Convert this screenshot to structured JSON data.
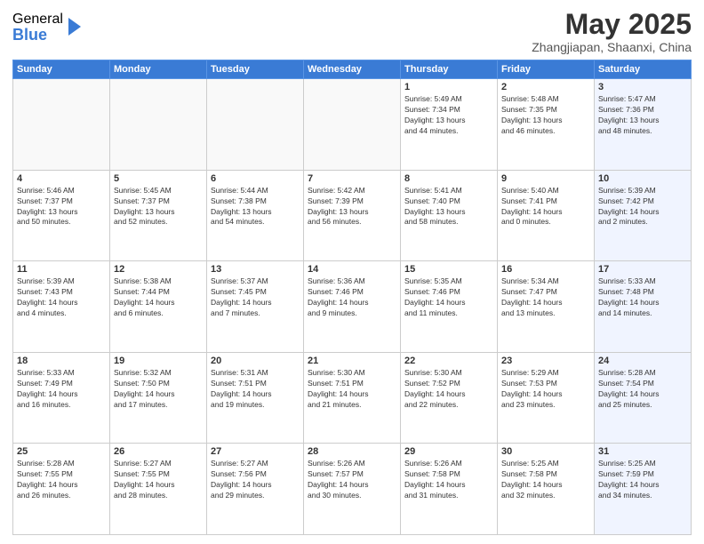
{
  "logo": {
    "general": "General",
    "blue": "Blue"
  },
  "title": {
    "month": "May 2025",
    "location": "Zhangjiapan, Shaanxi, China"
  },
  "weekdays": [
    "Sunday",
    "Monday",
    "Tuesday",
    "Wednesday",
    "Thursday",
    "Friday",
    "Saturday"
  ],
  "weeks": [
    [
      {
        "day": "",
        "info": ""
      },
      {
        "day": "",
        "info": ""
      },
      {
        "day": "",
        "info": ""
      },
      {
        "day": "",
        "info": ""
      },
      {
        "day": "1",
        "info": "Sunrise: 5:49 AM\nSunset: 7:34 PM\nDaylight: 13 hours\nand 44 minutes."
      },
      {
        "day": "2",
        "info": "Sunrise: 5:48 AM\nSunset: 7:35 PM\nDaylight: 13 hours\nand 46 minutes."
      },
      {
        "day": "3",
        "info": "Sunrise: 5:47 AM\nSunset: 7:36 PM\nDaylight: 13 hours\nand 48 minutes."
      }
    ],
    [
      {
        "day": "4",
        "info": "Sunrise: 5:46 AM\nSunset: 7:37 PM\nDaylight: 13 hours\nand 50 minutes."
      },
      {
        "day": "5",
        "info": "Sunrise: 5:45 AM\nSunset: 7:37 PM\nDaylight: 13 hours\nand 52 minutes."
      },
      {
        "day": "6",
        "info": "Sunrise: 5:44 AM\nSunset: 7:38 PM\nDaylight: 13 hours\nand 54 minutes."
      },
      {
        "day": "7",
        "info": "Sunrise: 5:42 AM\nSunset: 7:39 PM\nDaylight: 13 hours\nand 56 minutes."
      },
      {
        "day": "8",
        "info": "Sunrise: 5:41 AM\nSunset: 7:40 PM\nDaylight: 13 hours\nand 58 minutes."
      },
      {
        "day": "9",
        "info": "Sunrise: 5:40 AM\nSunset: 7:41 PM\nDaylight: 14 hours\nand 0 minutes."
      },
      {
        "day": "10",
        "info": "Sunrise: 5:39 AM\nSunset: 7:42 PM\nDaylight: 14 hours\nand 2 minutes."
      }
    ],
    [
      {
        "day": "11",
        "info": "Sunrise: 5:39 AM\nSunset: 7:43 PM\nDaylight: 14 hours\nand 4 minutes."
      },
      {
        "day": "12",
        "info": "Sunrise: 5:38 AM\nSunset: 7:44 PM\nDaylight: 14 hours\nand 6 minutes."
      },
      {
        "day": "13",
        "info": "Sunrise: 5:37 AM\nSunset: 7:45 PM\nDaylight: 14 hours\nand 7 minutes."
      },
      {
        "day": "14",
        "info": "Sunrise: 5:36 AM\nSunset: 7:46 PM\nDaylight: 14 hours\nand 9 minutes."
      },
      {
        "day": "15",
        "info": "Sunrise: 5:35 AM\nSunset: 7:46 PM\nDaylight: 14 hours\nand 11 minutes."
      },
      {
        "day": "16",
        "info": "Sunrise: 5:34 AM\nSunset: 7:47 PM\nDaylight: 14 hours\nand 13 minutes."
      },
      {
        "day": "17",
        "info": "Sunrise: 5:33 AM\nSunset: 7:48 PM\nDaylight: 14 hours\nand 14 minutes."
      }
    ],
    [
      {
        "day": "18",
        "info": "Sunrise: 5:33 AM\nSunset: 7:49 PM\nDaylight: 14 hours\nand 16 minutes."
      },
      {
        "day": "19",
        "info": "Sunrise: 5:32 AM\nSunset: 7:50 PM\nDaylight: 14 hours\nand 17 minutes."
      },
      {
        "day": "20",
        "info": "Sunrise: 5:31 AM\nSunset: 7:51 PM\nDaylight: 14 hours\nand 19 minutes."
      },
      {
        "day": "21",
        "info": "Sunrise: 5:30 AM\nSunset: 7:51 PM\nDaylight: 14 hours\nand 21 minutes."
      },
      {
        "day": "22",
        "info": "Sunrise: 5:30 AM\nSunset: 7:52 PM\nDaylight: 14 hours\nand 22 minutes."
      },
      {
        "day": "23",
        "info": "Sunrise: 5:29 AM\nSunset: 7:53 PM\nDaylight: 14 hours\nand 23 minutes."
      },
      {
        "day": "24",
        "info": "Sunrise: 5:28 AM\nSunset: 7:54 PM\nDaylight: 14 hours\nand 25 minutes."
      }
    ],
    [
      {
        "day": "25",
        "info": "Sunrise: 5:28 AM\nSunset: 7:55 PM\nDaylight: 14 hours\nand 26 minutes."
      },
      {
        "day": "26",
        "info": "Sunrise: 5:27 AM\nSunset: 7:55 PM\nDaylight: 14 hours\nand 28 minutes."
      },
      {
        "day": "27",
        "info": "Sunrise: 5:27 AM\nSunset: 7:56 PM\nDaylight: 14 hours\nand 29 minutes."
      },
      {
        "day": "28",
        "info": "Sunrise: 5:26 AM\nSunset: 7:57 PM\nDaylight: 14 hours\nand 30 minutes."
      },
      {
        "day": "29",
        "info": "Sunrise: 5:26 AM\nSunset: 7:58 PM\nDaylight: 14 hours\nand 31 minutes."
      },
      {
        "day": "30",
        "info": "Sunrise: 5:25 AM\nSunset: 7:58 PM\nDaylight: 14 hours\nand 32 minutes."
      },
      {
        "day": "31",
        "info": "Sunrise: 5:25 AM\nSunset: 7:59 PM\nDaylight: 14 hours\nand 34 minutes."
      }
    ]
  ]
}
